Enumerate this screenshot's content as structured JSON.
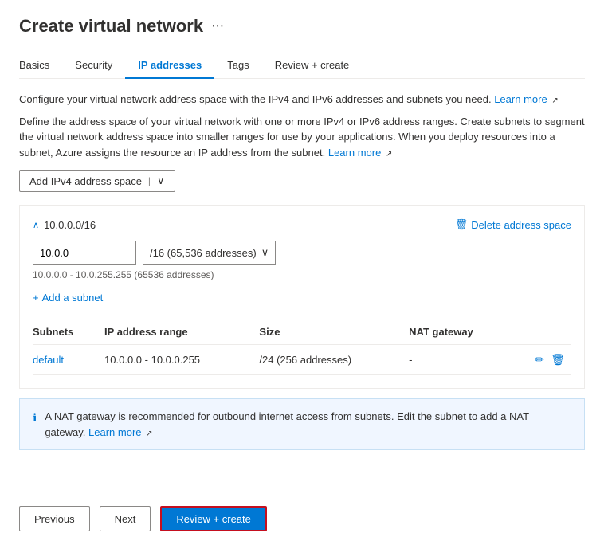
{
  "page": {
    "title": "Create virtual network",
    "more_icon": "···"
  },
  "tabs": [
    {
      "id": "basics",
      "label": "Basics",
      "active": false
    },
    {
      "id": "security",
      "label": "Security",
      "active": false
    },
    {
      "id": "ip-addresses",
      "label": "IP addresses",
      "active": true
    },
    {
      "id": "tags",
      "label": "Tags",
      "active": false
    },
    {
      "id": "review-create",
      "label": "Review + create",
      "active": false
    }
  ],
  "descriptions": {
    "line1_prefix": "Configure your virtual network address space with the IPv4 and IPv6 addresses and subnets you need.",
    "line1_link": "Learn more",
    "line2": "Define the address space of your virtual network with one or more IPv4 or IPv6 address ranges. Create subnets to segment the virtual network address space into smaller ranges for use by your applications. When you deploy resources into a subnet, Azure assigns the resource an IP address from the subnet.",
    "line2_link": "Learn more"
  },
  "add_ipv4_button": "Add IPv4 address space",
  "address_space": {
    "cidr": "10.0.0.0/16",
    "ip_value": "10.0.0",
    "prefix_label": "/16 (65,536 addresses)",
    "range_hint": "10.0.0.0 - 10.0.255.255 (65536 addresses)",
    "delete_label": "Delete address space",
    "add_subnet_label": "Add a subnet"
  },
  "table": {
    "headers": [
      "Subnets",
      "IP address range",
      "Size",
      "NAT gateway"
    ],
    "rows": [
      {
        "subnet": "default",
        "ip_range": "10.0.0.0 - 10.0.0.255",
        "size": "/24 (256 addresses)",
        "nat_gateway": "-"
      }
    ]
  },
  "nat_notification": {
    "text": "A NAT gateway is recommended for outbound internet access from subnets. Edit the subnet to add a NAT gateway.",
    "link": "Learn more"
  },
  "footer": {
    "previous_label": "Previous",
    "next_label": "Next",
    "review_create_label": "Review + create"
  },
  "icons": {
    "more": "···",
    "collapse": "∧",
    "delete": "🗑",
    "dropdown_arrow": "∨",
    "plus": "+",
    "info": "ℹ",
    "external_link": "↗",
    "edit": "✏",
    "trash": "🗑"
  }
}
